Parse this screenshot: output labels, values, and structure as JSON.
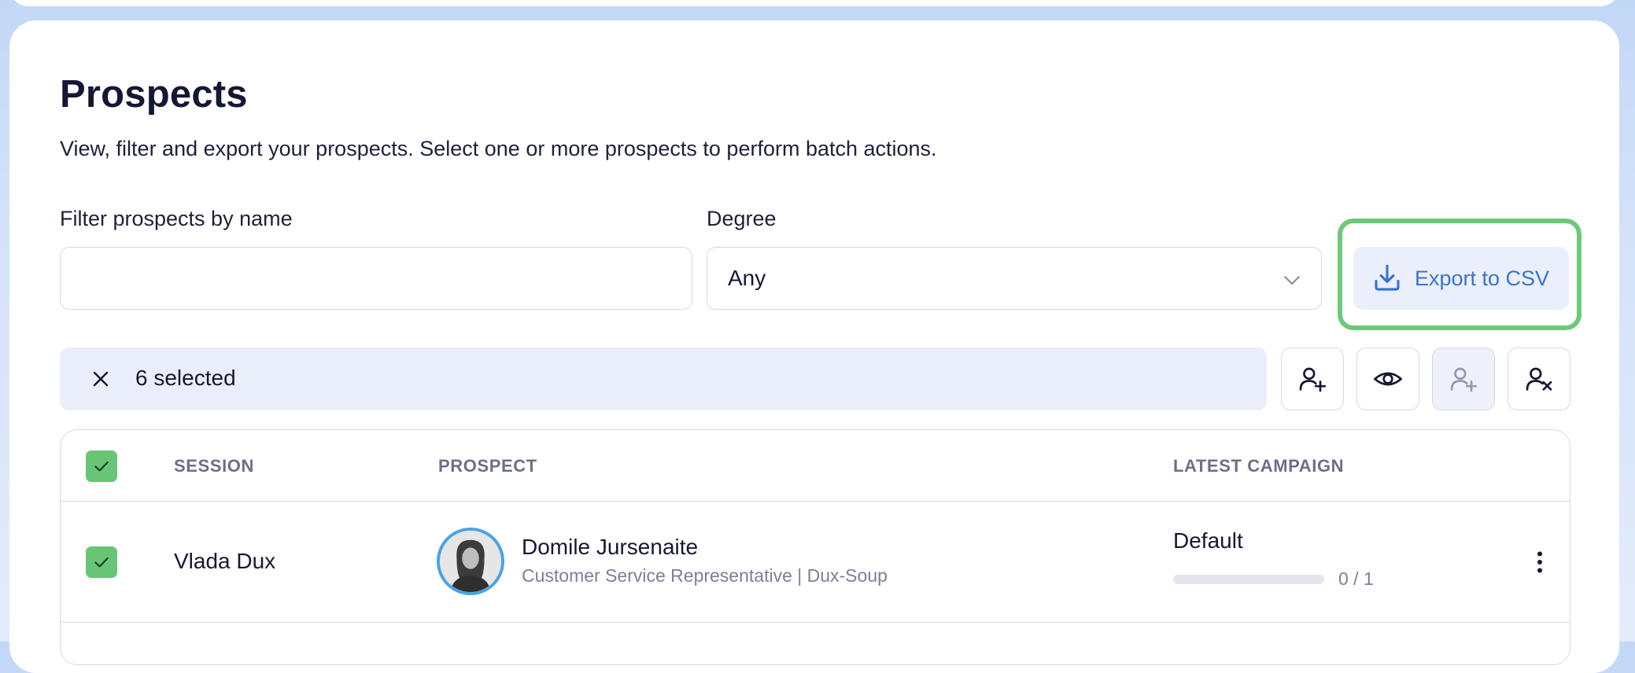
{
  "page": {
    "title": "Prospects",
    "subtitle": "View, filter and export your prospects. Select one or more prospects to perform batch actions."
  },
  "filters": {
    "name_label": "Filter prospects by name",
    "name_value": "",
    "degree_label": "Degree",
    "degree_value": "Any",
    "export_label": "Export to CSV"
  },
  "selection": {
    "count_label": "6 selected"
  },
  "actions": [
    {
      "icon": "user-plus-icon"
    },
    {
      "icon": "eye-icon"
    },
    {
      "icon": "user-plus-icon",
      "disabled": true
    },
    {
      "icon": "user-remove-icon"
    }
  ],
  "table": {
    "columns": [
      "SESSION",
      "PROSPECT",
      "LATEST CAMPAIGN"
    ],
    "rows": [
      {
        "checked": true,
        "session": "Vlada Dux",
        "prospect_name": "Domile Jursenaite",
        "prospect_title": "Customer Service Representative | Dux-Soup",
        "campaign": "Default",
        "progress_done": 0,
        "progress_total": 1,
        "progress_label": "0 / 1"
      }
    ]
  },
  "colors": {
    "accent": "#3a73d4",
    "success": "#69c576",
    "highlight": "#6dc97a"
  }
}
